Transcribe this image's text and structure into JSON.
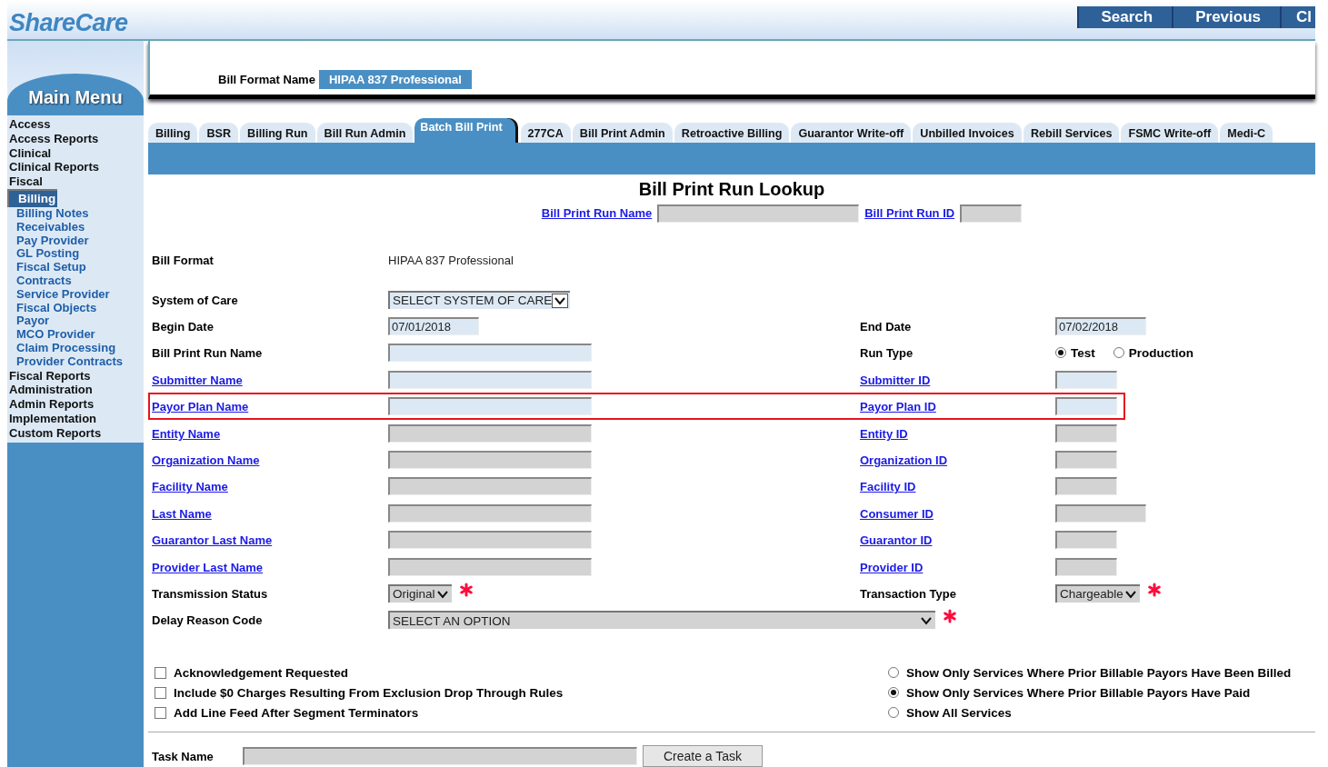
{
  "header": {
    "logo": "ShareCare",
    "buttons": [
      "Search",
      "Previous",
      "Cl"
    ]
  },
  "sidebar": {
    "title": "Main Menu",
    "items": [
      {
        "label": "Access",
        "selected": false
      },
      {
        "label": "Access Reports",
        "selected": false
      },
      {
        "label": "Clinical",
        "selected": false
      },
      {
        "label": "Clinical Reports",
        "selected": false
      },
      {
        "label": "Fiscal",
        "selected": false,
        "children": [
          {
            "label": "Billing",
            "selected": true
          },
          {
            "label": "Billing Notes",
            "selected": false
          },
          {
            "label": "Receivables",
            "selected": false
          },
          {
            "label": "Pay Provider",
            "selected": false
          },
          {
            "label": "GL Posting",
            "selected": false
          },
          {
            "label": "Fiscal Setup",
            "selected": false
          },
          {
            "label": "Contracts",
            "selected": false
          },
          {
            "label": "Service Provider",
            "selected": false
          },
          {
            "label": "Fiscal Objects",
            "selected": false
          },
          {
            "label": "Payor",
            "selected": false
          },
          {
            "label": "MCO Provider",
            "selected": false
          },
          {
            "label": "Claim Processing",
            "selected": false
          },
          {
            "label": "Provider Contracts",
            "selected": false
          }
        ]
      },
      {
        "label": "Fiscal Reports",
        "selected": false
      },
      {
        "label": "Administration",
        "selected": false
      },
      {
        "label": "Admin Reports",
        "selected": false
      },
      {
        "label": "Implementation",
        "selected": false
      },
      {
        "label": "Custom Reports",
        "selected": false
      }
    ]
  },
  "bill_format_name": {
    "label": "Bill Format Name",
    "value": "HIPAA 837 Professional"
  },
  "tabs": [
    {
      "label": "Billing",
      "selected": false
    },
    {
      "label": "BSR",
      "selected": false
    },
    {
      "label": "Billing Run",
      "selected": false
    },
    {
      "label": "Bill Run Admin",
      "selected": false
    },
    {
      "label": "Batch Bill Print",
      "selected": true
    },
    {
      "label": "277CA",
      "selected": false
    },
    {
      "label": "Bill Print Admin",
      "selected": false
    },
    {
      "label": "Retroactive Billing",
      "selected": false
    },
    {
      "label": "Guarantor Write-off",
      "selected": false
    },
    {
      "label": "Unbilled Invoices",
      "selected": false
    },
    {
      "label": "Rebill Services",
      "selected": false
    },
    {
      "label": "FSMC Write-off",
      "selected": false
    },
    {
      "label": "Medi-C",
      "selected": false
    }
  ],
  "lookup": {
    "title": "Bill Print Run Lookup",
    "run_name_link": "Bill Print Run Name",
    "run_id_link": "Bill Print Run ID"
  },
  "rows": [
    {
      "highlighted": false,
      "left": {
        "label": "Bill Format",
        "link": false,
        "kind": "static",
        "value": "HIPAA 837 Professional"
      }
    },
    {
      "highlighted": false,
      "left": {
        "label": "System of Care",
        "link": false,
        "kind": "select",
        "value": "SELECT SYSTEM OF CARE",
        "disabled": false
      }
    },
    {
      "highlighted": false,
      "left": {
        "label": "Begin Date",
        "link": false,
        "kind": "date",
        "value": "07/01/2018",
        "disabled": false
      },
      "right": {
        "label": "End Date",
        "link": false,
        "kind": "date",
        "value": "07/02/2018",
        "disabled": false
      }
    },
    {
      "highlighted": false,
      "left": {
        "label": "Bill Print Run Name",
        "link": false,
        "kind": "name",
        "disabled": false
      },
      "right": {
        "label": "Run Type",
        "link": false,
        "kind": "radios",
        "options": [
          {
            "label": "Test",
            "selected": true
          },
          {
            "label": "Production",
            "selected": false
          }
        ]
      }
    },
    {
      "highlighted": false,
      "left": {
        "label": "Submitter Name",
        "link": true,
        "kind": "name",
        "disabled": false
      },
      "right": {
        "label": "Submitter ID",
        "link": true,
        "kind": "id",
        "disabled": false
      }
    },
    {
      "highlighted": true,
      "left": {
        "label": "Payor Plan Name",
        "link": true,
        "kind": "name",
        "disabled": false
      },
      "right": {
        "label": "Payor Plan ID",
        "link": true,
        "kind": "id",
        "disabled": false
      }
    },
    {
      "highlighted": false,
      "left": {
        "label": "Entity Name",
        "link": true,
        "kind": "name",
        "disabled": true
      },
      "right": {
        "label": "Entity ID",
        "link": true,
        "kind": "id",
        "disabled": true
      }
    },
    {
      "highlighted": false,
      "left": {
        "label": "Organization Name",
        "link": true,
        "kind": "name",
        "disabled": true
      },
      "right": {
        "label": "Organization ID",
        "link": true,
        "kind": "id",
        "disabled": true
      }
    },
    {
      "highlighted": false,
      "left": {
        "label": "Facility Name",
        "link": true,
        "kind": "name",
        "disabled": true
      },
      "right": {
        "label": "Facility ID",
        "link": true,
        "kind": "id",
        "disabled": true
      }
    },
    {
      "highlighted": false,
      "left": {
        "label": "Last Name",
        "link": true,
        "kind": "name",
        "disabled": true
      },
      "right": {
        "label": "Consumer ID",
        "link": true,
        "kind": "date",
        "disabled": true
      }
    },
    {
      "highlighted": false,
      "left": {
        "label": "Guarantor Last Name",
        "link": true,
        "kind": "name",
        "disabled": true
      },
      "right": {
        "label": "Guarantor ID",
        "link": true,
        "kind": "id",
        "disabled": true
      }
    },
    {
      "highlighted": false,
      "left": {
        "label": "Provider Last Name",
        "link": true,
        "kind": "name",
        "disabled": true
      },
      "right": {
        "label": "Provider ID",
        "link": true,
        "kind": "id",
        "disabled": true
      }
    },
    {
      "highlighted": false,
      "left": {
        "label": "Transmission Status",
        "link": false,
        "kind": "select",
        "value": "Original",
        "disabled": true,
        "required": true
      },
      "right": {
        "label": "Transaction Type",
        "link": false,
        "kind": "select",
        "value": "Chargeable",
        "disabled": true,
        "required": true
      }
    },
    {
      "highlighted": false,
      "left": {
        "label": "Delay Reason Code",
        "link": false,
        "kind": "wide-select",
        "value": "SELECT AN OPTION",
        "disabled": true,
        "required": true
      }
    }
  ],
  "checkboxes": [
    {
      "label": "Acknowledgement Requested",
      "checked": false
    },
    {
      "label": "Include $0 Charges Resulting From Exclusion Drop Through Rules",
      "checked": false
    },
    {
      "label": "Add Line Feed After Segment Terminators",
      "checked": false
    }
  ],
  "service_filter": [
    {
      "label": "Show Only Services Where Prior Billable Payors Have Been Billed",
      "selected": false
    },
    {
      "label": "Show Only Services Where Prior Billable Payors Have Paid",
      "selected": true
    },
    {
      "label": "Show All Services",
      "selected": false
    }
  ],
  "task": {
    "label": "Task Name",
    "button": "Create a Task"
  }
}
